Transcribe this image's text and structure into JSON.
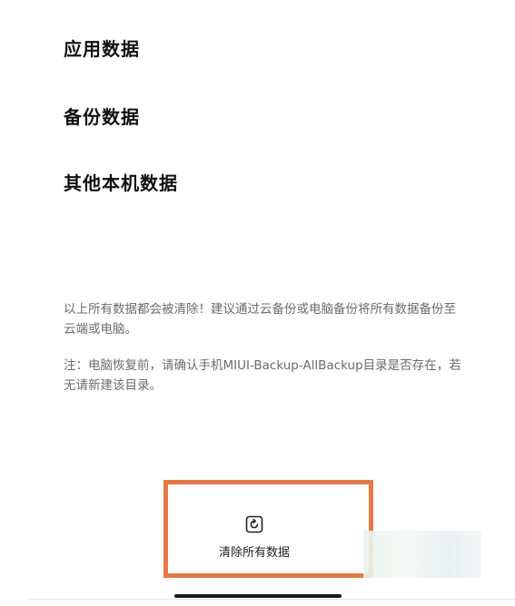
{
  "sections": [
    {
      "label": "应用数据"
    },
    {
      "label": "备份数据"
    },
    {
      "label": "其他本机数据"
    }
  ],
  "notes": {
    "warning": "以上所有数据都会被清除！建议通过云备份或电脑备份将所有数据备份至云端或电脑。",
    "tip": "注：电脑恢复前，请确认手机MIUI-Backup-AllBackup目录是否存在，若无请新建该目录。"
  },
  "action": {
    "label": "清除所有数据",
    "icon": "clear-data-icon",
    "highlight_color": "#e57a45"
  }
}
